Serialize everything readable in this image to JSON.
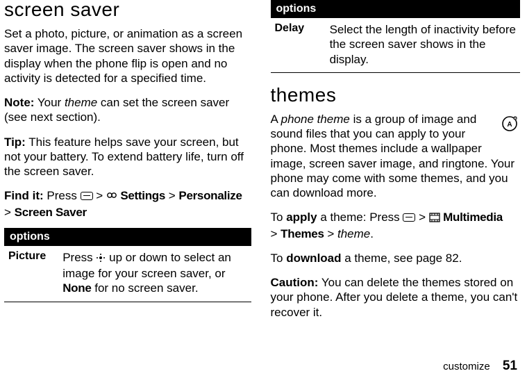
{
  "page": {
    "section_label": "customize",
    "number": "51"
  },
  "left": {
    "heading": "screen saver",
    "intro": "Set a photo, picture, or animation as a screen saver image. The screen saver shows in the display when the phone flip is open and no activity is detected for a specified time.",
    "note_label": "Note:",
    "note_text_a": " Your ",
    "note_theme": "theme",
    "note_text_b": " can set the screen saver (see next section).",
    "tip_label": "Tip:",
    "tip_text": " This feature helps save your screen, but not your battery. To extend battery life, turn off the screen saver.",
    "find_label": "Find it:",
    "find_press": " Press ",
    "find_gt1": " > ",
    "find_settings": " Settings",
    "find_gt2": " > ",
    "find_personalize": "Personalize",
    "find_gt3": "> ",
    "find_screensaver": "Screen Saver",
    "table_header": "options",
    "row_key": "Picture",
    "row_val_a": "Press ",
    "row_val_b": " up or down to select an image for your screen saver, or ",
    "row_none": "None",
    "row_val_c": " for no screen saver."
  },
  "right": {
    "table_header": "options",
    "row_key": "Delay",
    "row_val": "Select the length of inactivity before the screen saver shows in the display.",
    "heading": "themes",
    "para1_a": "A ",
    "para1_theme": "phone theme",
    "para1_b": " is a group of image and sound files that you can apply to your phone. Most themes include a wallpaper image, screen saver image, and ringtone. Your phone may come with some themes, and you can download more.",
    "apply_a": "To ",
    "apply_b": "apply",
    "apply_c": " a theme: Press ",
    "apply_gt1": " > ",
    "apply_mm": " Multimedia",
    "apply_gt2": "> ",
    "apply_themes": "Themes",
    "apply_gt3": " > ",
    "apply_theme_i": "theme",
    "apply_dot": ".",
    "download_a": "To ",
    "download_b": "download",
    "download_c": " a theme, see page 82.",
    "caution_label": "Caution:",
    "caution_text": " You can delete the themes stored on your phone. After you delete a theme, you can't recover it."
  }
}
